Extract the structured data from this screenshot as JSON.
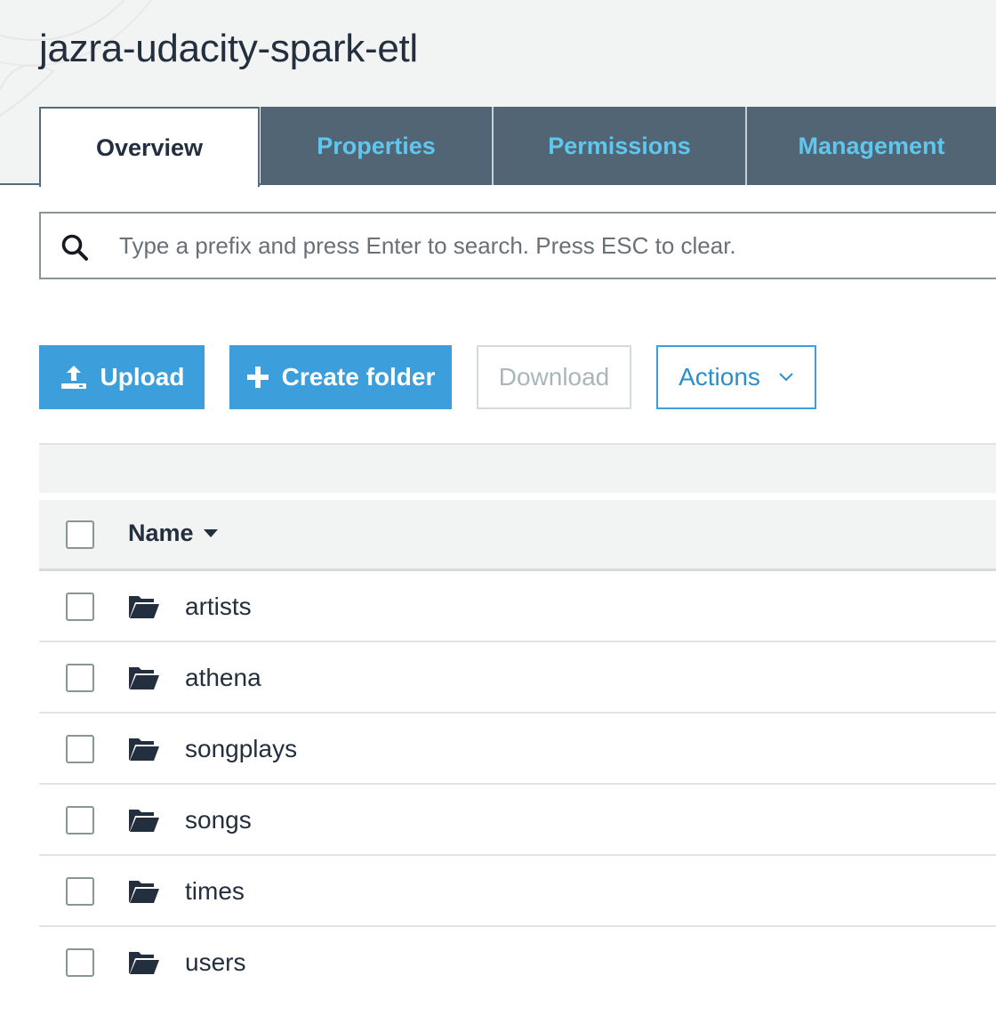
{
  "bucket": {
    "title": "jazra-udacity-spark-etl"
  },
  "tabs": [
    {
      "label": "Overview",
      "active": true
    },
    {
      "label": "Properties",
      "active": false
    },
    {
      "label": "Permissions",
      "active": false
    },
    {
      "label": "Management",
      "active": false
    }
  ],
  "search": {
    "placeholder": "Type a prefix and press Enter to search. Press ESC to clear.",
    "value": "",
    "icon": "search-icon"
  },
  "toolbar": {
    "upload_label": "Upload",
    "upload_icon": "upload-icon",
    "create_folder_label": "Create folder",
    "create_folder_icon": "plus-icon",
    "download_label": "Download",
    "actions_label": "Actions",
    "actions_icon": "chevron-down-icon"
  },
  "table": {
    "name_header": "Name",
    "sort_icon": "caret-down-icon",
    "rows": [
      {
        "name": "artists",
        "type": "folder"
      },
      {
        "name": "athena",
        "type": "folder"
      },
      {
        "name": "songplays",
        "type": "folder"
      },
      {
        "name": "songs",
        "type": "folder"
      },
      {
        "name": "times",
        "type": "folder"
      },
      {
        "name": "users",
        "type": "folder"
      }
    ]
  },
  "colors": {
    "primary_button": "#3c9fdb",
    "tab_inactive_bg": "#516574",
    "tab_inactive_text": "#5fc7ee",
    "text": "#232f3e"
  }
}
